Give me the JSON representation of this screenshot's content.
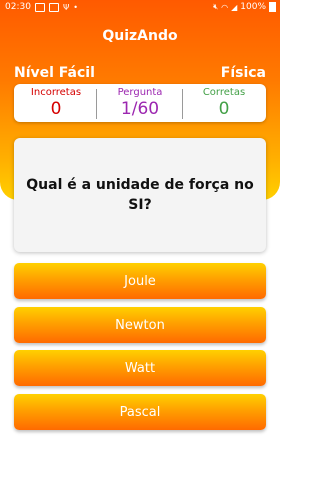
{
  "status_bar": {
    "time": "02:30",
    "battery": "100%"
  },
  "header": {
    "app_title": "QuizAndo",
    "level": "Nível Fácil",
    "subject": "Física"
  },
  "score": {
    "wrong_label": "Incorretas",
    "wrong_value": "0",
    "question_label": "Pergunta",
    "question_value": "1/60",
    "right_label": "Corretas",
    "right_value": "0",
    "colors": {
      "wrong": "#d50000",
      "question": "#9c27b0",
      "right": "#43a047"
    }
  },
  "question": {
    "text": "Qual é a unidade de força no SI?"
  },
  "answers": [
    {
      "label": "Joule"
    },
    {
      "label": "Newton"
    },
    {
      "label": "Watt"
    },
    {
      "label": "Pascal"
    }
  ],
  "colors": {
    "header_top": "#ff5a00",
    "header_bottom": "#ffd000"
  }
}
